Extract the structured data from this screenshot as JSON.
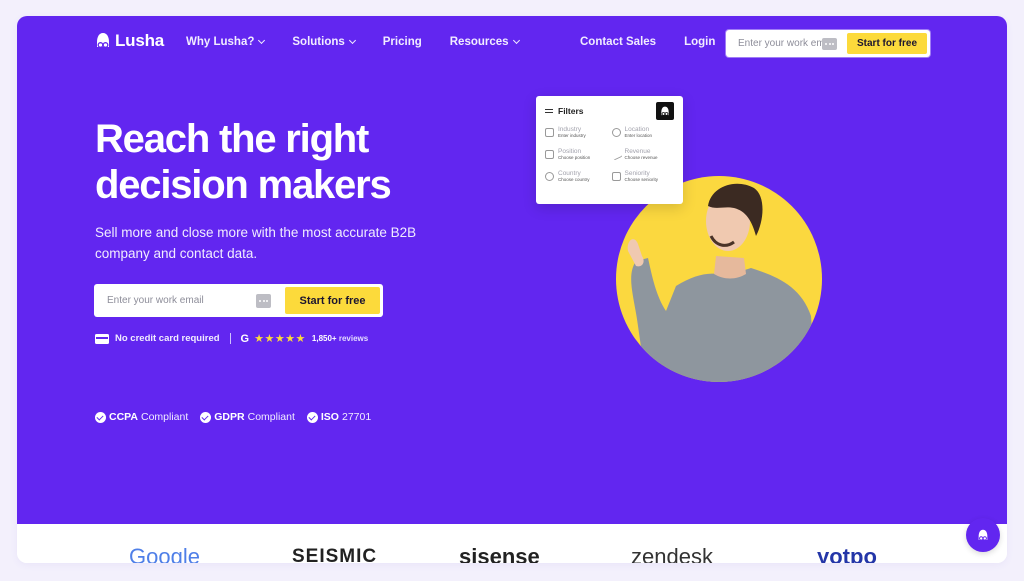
{
  "colors": {
    "brand_purple": "#6226f0",
    "accent_yellow": "#fcda3b",
    "page_background": "#f3f0fc"
  },
  "nav": {
    "logo_text": "Lusha",
    "links": [
      {
        "label": "Why Lusha?",
        "has_dropdown": true
      },
      {
        "label": "Solutions",
        "has_dropdown": true
      },
      {
        "label": "Pricing",
        "has_dropdown": false
      },
      {
        "label": "Resources",
        "has_dropdown": true
      }
    ],
    "contact_sales": "Contact Sales",
    "login": "Login",
    "email_placeholder": "Enter your work email",
    "cta_label": "Start for free"
  },
  "hero": {
    "headline_line1": "Reach the right",
    "headline_line2": "decision makers",
    "subhead": "Sell more and close more with the most accurate B2B company and contact data.",
    "email_placeholder": "Enter your work email",
    "cta_label": "Start for free",
    "no_credit_card": "No credit card required",
    "rating_stars": 5,
    "rating_stars_glyphs": "★★★★★",
    "review_count": "1,850+",
    "review_label": "reviews",
    "compliance": [
      {
        "bold": "CCPA",
        "text": "Compliant"
      },
      {
        "bold": "GDPR",
        "text": "Compliant"
      },
      {
        "bold": "ISO",
        "text": "27701"
      }
    ]
  },
  "filters_card": {
    "title": "Filters",
    "items": [
      {
        "label": "Industry",
        "sub": "Enter industry",
        "icon": "industry-icon"
      },
      {
        "label": "Location",
        "sub": "Enter location",
        "icon": "location-pin-icon"
      },
      {
        "label": "Position",
        "sub": "Choose position",
        "icon": "briefcase-icon"
      },
      {
        "label": "Revenue",
        "sub": "Choose revenue",
        "icon": "trend-icon"
      },
      {
        "label": "Country",
        "sub": "Choose country",
        "icon": "globe-icon"
      },
      {
        "label": "Seniority",
        "sub": "Choose seniority",
        "icon": "seniority-icon"
      }
    ]
  },
  "customer_logos": [
    "Google",
    "SEISMIC",
    "sisense",
    "zendesk",
    "yotpo"
  ]
}
